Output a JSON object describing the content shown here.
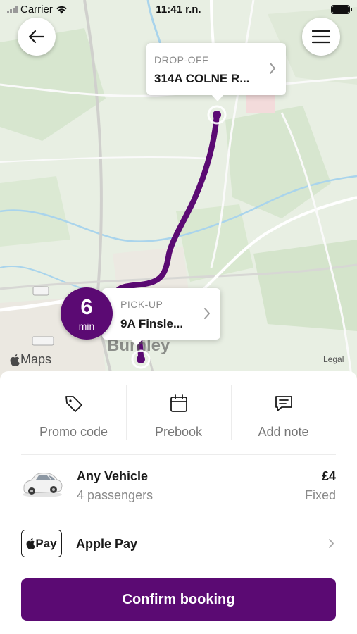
{
  "status_bar": {
    "carrier": "Carrier",
    "time": "11:41 r.n."
  },
  "map": {
    "town_label": "Burnley",
    "maps_brand": "Maps",
    "legal_link": "Legal",
    "route_color": "#5b0a73"
  },
  "dropoff": {
    "label": "DROP-OFF",
    "address": "314A COLNE R..."
  },
  "pickup": {
    "label": "PICK-UP",
    "address": "9A Finsle..."
  },
  "eta": {
    "value": "6",
    "unit": "min"
  },
  "actions": [
    {
      "label": "Promo code",
      "icon": "tag-icon"
    },
    {
      "label": "Prebook",
      "icon": "calendar-icon"
    },
    {
      "label": "Add note",
      "icon": "note-icon"
    }
  ],
  "vehicle": {
    "name": "Any Vehicle",
    "passengers": "4 passengers",
    "price": "£4",
    "price_type": "Fixed"
  },
  "payment": {
    "badge": "Pay",
    "method": "Apple Pay"
  },
  "confirm_button": "Confirm booking",
  "colors": {
    "brand": "#5b0a73"
  }
}
